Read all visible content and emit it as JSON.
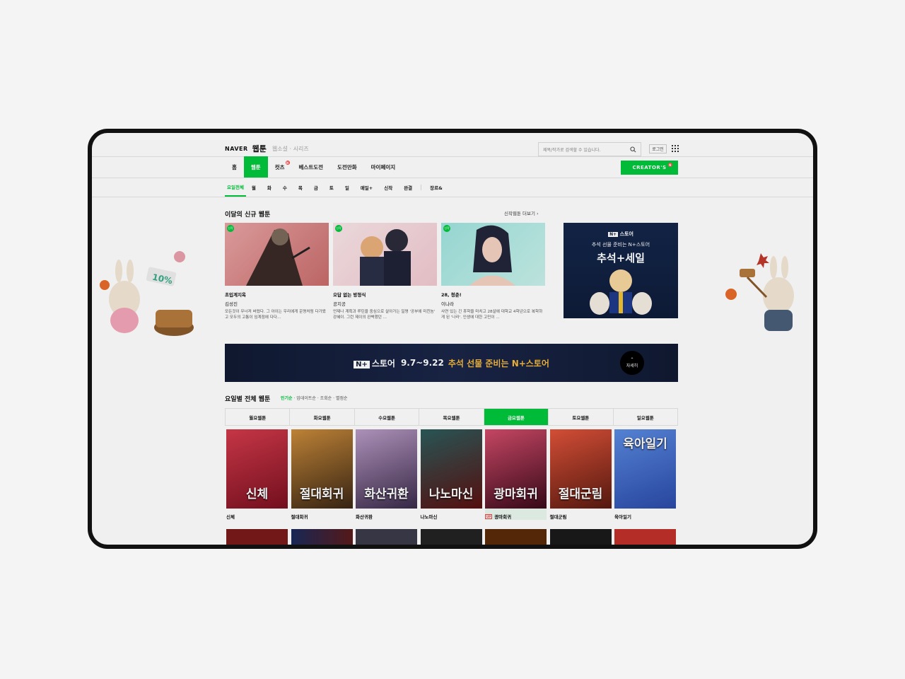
{
  "header": {
    "naver": "NAVER",
    "webtoon": "웹툰",
    "sub": "웹소설 · 시리즈",
    "search_placeholder": "제목/작가로 검색할 수 있습니다.",
    "login": "로그인"
  },
  "mainnav": [
    "홈",
    "웹툰",
    "컷츠",
    "베스트도전",
    "도전만화",
    "마이페이지"
  ],
  "creator": "CREATOR'S",
  "subnav": [
    "요일전체",
    "월",
    "화",
    "수",
    "목",
    "금",
    "토",
    "일",
    "매일+",
    "신작",
    "완결",
    "장르&"
  ],
  "new_section": {
    "title": "이달의 신규 웹툰",
    "more": "신작웹툰 더보기",
    "cards": [
      {
        "title": "초입계지옥",
        "author": "김성진",
        "desc": "모든것이 무너져 버렸다. 그 아이는 우리에게 운명처럼 다가왔고 모두의 고통이 임계점에 다다..."
      },
      {
        "title": "오답 없는 방정식",
        "author": "공지공",
        "desc": "언제나 계획과 루틴을 중심으로 살아가는 일명 '공부에 미친놈' 강혜이. 그런 제이의 완벽했던 ..."
      },
      {
        "title": "28, 청춘!",
        "author": "이나라",
        "desc": "사연 있는 긴 휴학을 마치고 28살에 대학교 4학년으로 복학하게 된 '나라'. 인생에 대한 고민이 ..."
      }
    ],
    "badge_new": "신작",
    "promo": {
      "brand": "스토어",
      "sub": "추석 선물 준비는 N+스토어",
      "big": "추석+세일"
    }
  },
  "banner": {
    "brand": "스토어",
    "date": "9.7~9.22",
    "text": "추석 선물 준비는 N+스토어",
    "more": "자세히"
  },
  "weekly": {
    "title": "요일별 전체 웹툰",
    "sort": [
      "인기순",
      "업데이트순",
      "조회순",
      "별점순"
    ],
    "tabs": [
      "월요웹툰",
      "화요웹툰",
      "수요웹툰",
      "목요웹툰",
      "금요웹툰",
      "토요웹툰",
      "일요웹툰"
    ],
    "items": [
      {
        "name": "신체",
        "cover_text": "신체"
      },
      {
        "name": "절대회귀",
        "cover_text": "절대회귀"
      },
      {
        "name": "화산귀환",
        "cover_text": "화산귀환"
      },
      {
        "name": "나노마신",
        "cover_text": "나노마신"
      },
      {
        "name": "광마회귀",
        "cover_text": "광마회귀"
      },
      {
        "name": "절대군림",
        "cover_text": "절대군림"
      },
      {
        "name": "육아일기",
        "cover_text": "육아일기"
      }
    ],
    "up_badge": "UP"
  },
  "colors": {
    "accent": "#00c73c",
    "promo_bg": "#14264a",
    "banner_text": "#f5b93d"
  }
}
